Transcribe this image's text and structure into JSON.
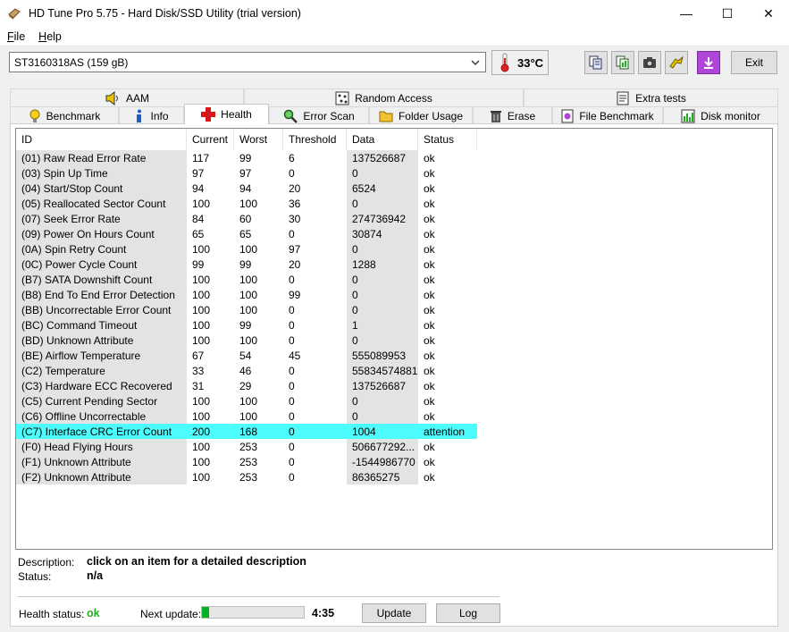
{
  "window": {
    "title": "HD Tune Pro 5.75 - Hard Disk/SSD Utility (trial version)",
    "minimize": "—",
    "maximize": "☐",
    "close": "✕"
  },
  "menu": {
    "file": {
      "u": "F",
      "rest": "ile"
    },
    "help": {
      "u": "H",
      "rest": "elp"
    }
  },
  "toolbar": {
    "drive": "ST3160318AS (159 gB)",
    "temperature": "33°C",
    "exit_label": "Exit",
    "icons": [
      "copy-info-icon",
      "copy-results-icon",
      "screenshot-icon",
      "options-icon",
      "save-icon"
    ]
  },
  "tabs": {
    "row1": [
      "AAM",
      "Random Access",
      "Extra tests"
    ],
    "row2": [
      "Benchmark",
      "Info",
      "Health",
      "Error Scan",
      "Folder Usage",
      "Erase",
      "File Benchmark",
      "Disk monitor"
    ],
    "active": "Health"
  },
  "table": {
    "headers": [
      "ID",
      "Current",
      "Worst",
      "Threshold",
      "Data",
      "Status"
    ],
    "rows": [
      [
        "(01) Raw Read Error Rate",
        "117",
        "99",
        "6",
        "137526687",
        "ok"
      ],
      [
        "(03) Spin Up Time",
        "97",
        "97",
        "0",
        "0",
        "ok"
      ],
      [
        "(04) Start/Stop Count",
        "94",
        "94",
        "20",
        "6524",
        "ok"
      ],
      [
        "(05) Reallocated Sector Count",
        "100",
        "100",
        "36",
        "0",
        "ok"
      ],
      [
        "(07) Seek Error Rate",
        "84",
        "60",
        "30",
        "274736942",
        "ok"
      ],
      [
        "(09) Power On Hours Count",
        "65",
        "65",
        "0",
        "30874",
        "ok"
      ],
      [
        "(0A) Spin Retry Count",
        "100",
        "100",
        "97",
        "0",
        "ok"
      ],
      [
        "(0C) Power Cycle Count",
        "99",
        "99",
        "20",
        "1288",
        "ok"
      ],
      [
        "(B7) SATA Downshift Count",
        "100",
        "100",
        "0",
        "0",
        "ok"
      ],
      [
        "(B8) End To End Error Detection",
        "100",
        "100",
        "99",
        "0",
        "ok"
      ],
      [
        "(BB) Uncorrectable Error Count",
        "100",
        "100",
        "0",
        "0",
        "ok"
      ],
      [
        "(BC) Command Timeout",
        "100",
        "99",
        "0",
        "1",
        "ok"
      ],
      [
        "(BD) Unknown Attribute",
        "100",
        "100",
        "0",
        "0",
        "ok"
      ],
      [
        "(BE) Airflow Temperature",
        "67",
        "54",
        "45",
        "555089953",
        "ok"
      ],
      [
        "(C2) Temperature",
        "33",
        "46",
        "0",
        "55834574881",
        "ok"
      ],
      [
        "(C3) Hardware ECC Recovered",
        "31",
        "29",
        "0",
        "137526687",
        "ok"
      ],
      [
        "(C5) Current Pending Sector",
        "100",
        "100",
        "0",
        "0",
        "ok"
      ],
      [
        "(C6) Offline Uncorrectable",
        "100",
        "100",
        "0",
        "0",
        "ok"
      ],
      [
        "(C7) Interface CRC Error Count",
        "200",
        "168",
        "0",
        "1004",
        "attention"
      ],
      [
        "(F0) Head Flying Hours",
        "100",
        "253",
        "0",
        "506677292...",
        "ok"
      ],
      [
        "(F1) Unknown Attribute",
        "100",
        "253",
        "0",
        "-1544986770",
        "ok"
      ],
      [
        "(F2) Unknown Attribute",
        "100",
        "253",
        "0",
        "86365275",
        "ok"
      ]
    ],
    "highlight_color": "#4dfcfc"
  },
  "details": {
    "description_label": "Description:",
    "description_value": "click on an item for a detailed description",
    "status_label": "Status:",
    "status_value": "n/a"
  },
  "footer": {
    "health_label": "Health status:",
    "health_value": "ok",
    "next_update_label": "Next update:",
    "progress_fraction": 0.07,
    "countdown": "4:35",
    "update_label": "Update",
    "log_label": "Log"
  }
}
